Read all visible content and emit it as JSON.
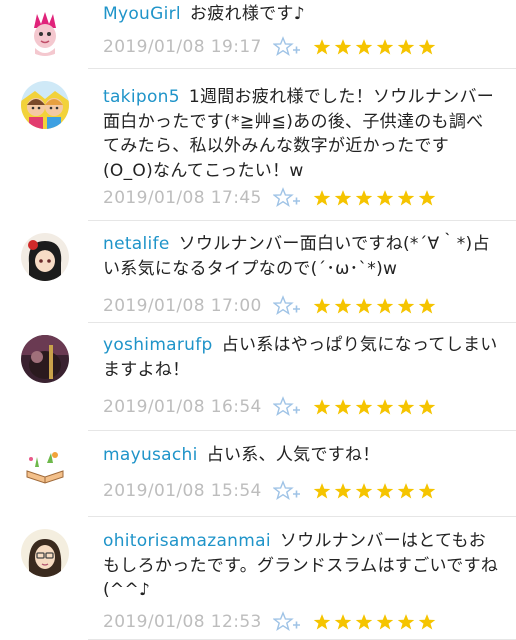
{
  "comments": [
    {
      "username": "MyouGirl",
      "message": "お疲れ様です♪",
      "date": "2019/01/08 19:17",
      "stars": 6
    },
    {
      "username": "takipon5",
      "message": "1週間お疲れ様でした！ソウルナンバー面白かったです(*≧艸≦)あの後、子供達のも調べてみたら、私以外みんな数字が近かったです(O_O)なんてこったい！w",
      "date": "2019/01/08 17:45",
      "stars": 6
    },
    {
      "username": "netalife",
      "message": "ソウルナンバー面白いですね(*´∀｀*)占い系気になるタイプなので(´･ω･`*)w",
      "date": "2019/01/08 17:00",
      "stars": 6
    },
    {
      "username": "yoshimarufp",
      "message": "占い系はやっぱり気になってしまいますよね！",
      "date": "2019/01/08 16:54",
      "stars": 6
    },
    {
      "username": "mayusachi",
      "message": "占い系、人気ですね！",
      "date": "2019/01/08 15:54",
      "stars": 6
    },
    {
      "username": "ohitorisamazanmai",
      "message": "ソウルナンバーはとてもおもしろかったです。グランドスラムはすごいですね(^^♪",
      "date": "2019/01/08 12:53",
      "stars": 6
    }
  ],
  "colors": {
    "username": "#1f94c9",
    "star": "#f5c400",
    "date": "#bdbdbd",
    "add_star": "#9fc3e6"
  },
  "icons": {
    "add_star": "star-plus-icon",
    "star": "star-icon"
  }
}
